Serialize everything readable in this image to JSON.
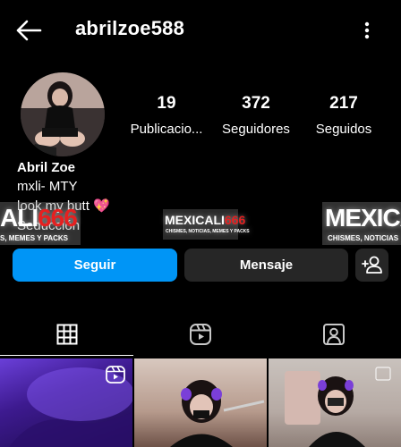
{
  "header": {
    "username": "abrilzoe588",
    "back_icon": "arrow-left-icon",
    "more_icon": "more-vertical-icon"
  },
  "profile": {
    "stats": {
      "posts": {
        "value": "19",
        "label": "Publicacio..."
      },
      "followers": {
        "value": "372",
        "label": "Seguidores"
      },
      "following": {
        "value": "217",
        "label": "Seguidos"
      }
    },
    "bio": {
      "name": "Abril Zoe",
      "line1": "mxli- MTY",
      "line2": "look my butt 💖",
      "line3": "Seducción"
    }
  },
  "watermark": {
    "left_big_white": "ALI",
    "left_big_red": "666",
    "left_small": "S, MEMES Y PACKS",
    "mid_big_white": "MEXICALI",
    "mid_big_red": "666",
    "mid_small": "CHISMES, NOTICIAS, MEMES Y PACKS",
    "right_big": "MEXICA",
    "right_small": "CHISMES, NOTICIAS"
  },
  "actions": {
    "follow_label": "Seguir",
    "message_label": "Mensaje",
    "add_user_icon": "add-person-icon"
  },
  "tabs": [
    {
      "icon": "grid-icon",
      "active": true
    },
    {
      "icon": "reels-icon",
      "active": false
    },
    {
      "icon": "tagged-icon",
      "active": false
    }
  ],
  "colors": {
    "accent": "#0095f6",
    "button_dark": "#262626",
    "background": "#000000"
  }
}
